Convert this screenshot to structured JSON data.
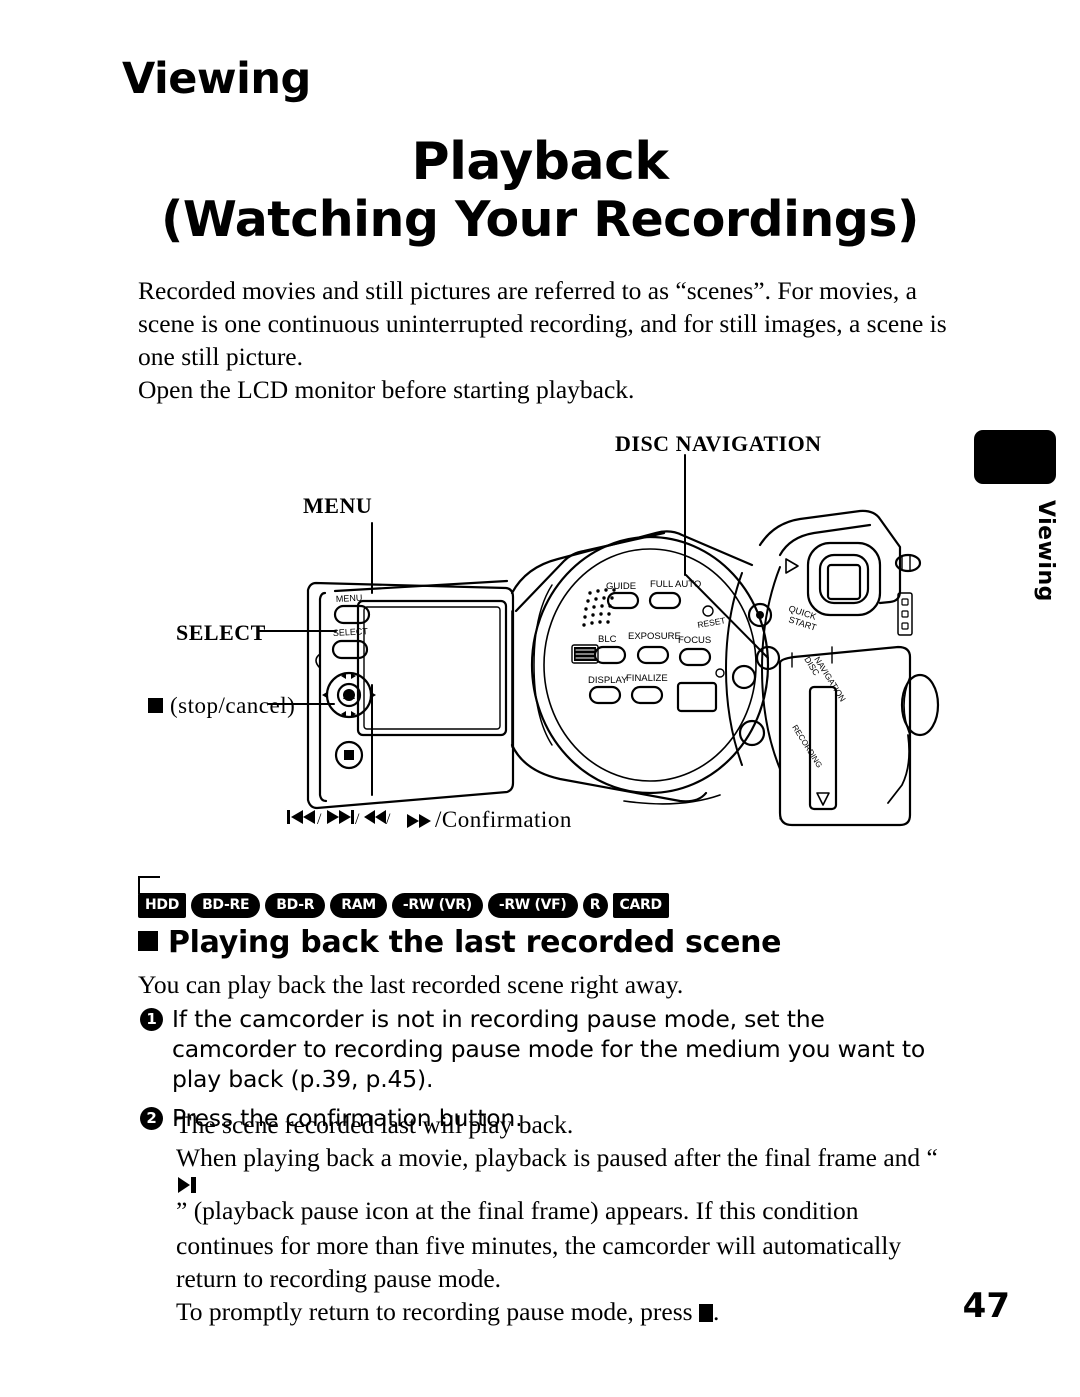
{
  "chapter": {
    "title": "Viewing"
  },
  "doc_title": {
    "line1": "Playback",
    "line2": "(Watching Your Recordings)"
  },
  "intro": {
    "p1": "Recorded movies and still pictures are referred to as “scenes”. For movies, a scene is one continuous uninterrupted recording, and for still images, a scene is one still picture.",
    "p2": "Open the LCD monitor before starting playback."
  },
  "side_tab": {
    "label": "Viewing"
  },
  "figure": {
    "callouts": {
      "disc_navigation": "DISC NAVIGATION",
      "menu": "MENU",
      "select": "SELECT",
      "stop_cancel": "(stop/cancel)",
      "confirmation": "/Confirmation",
      "confirmation_glyphs": "⏮/⏭/◀◀/▶▶"
    },
    "device_labels": {
      "menu": "MENU",
      "select": "SELECT",
      "guide": "GUIDE",
      "full_auto": "FULL AUTO",
      "reset": "RESET",
      "blc": "BLC",
      "exposure": "EXPOSURE",
      "focus": "FOCUS",
      "display": "DISPLAY",
      "finalize": "FINALIZE",
      "quick_start": "QUICK START",
      "disc_navigation": "DISC NAVIGATION",
      "recording": "RECORDING"
    }
  },
  "media_badges": [
    {
      "text": "HDD",
      "shape": "rect"
    },
    {
      "text": "BD-RE",
      "shape": "pill"
    },
    {
      "text": "BD-R",
      "shape": "pill"
    },
    {
      "text": "RAM",
      "shape": "pill"
    },
    {
      "text": "-RW (VR)",
      "shape": "pill"
    },
    {
      "text": "-RW (VF)",
      "shape": "pill"
    },
    {
      "text": "R",
      "shape": "circle"
    },
    {
      "text": "CARD",
      "shape": "rect"
    }
  ],
  "section": {
    "heading": "Playing back the last recorded scene",
    "subtitle": "You can play back the last recorded scene right away."
  },
  "steps": [
    {
      "num": "1",
      "text": "If the camcorder is not in recording pause mode, set the camcorder to recording pause mode for the medium you want to play back (p.39, p.45)."
    },
    {
      "num": "2",
      "text": "Press the confirmation button."
    }
  ],
  "closing": {
    "p1": "The scene recorded last will play back.",
    "p2_a": "When playing back a movie, playback is paused after the final frame and “",
    "p2_glyph": "▶❙",
    "p2_b": "” (playback pause icon at the final frame) appears. If this condition continues for more than five minutes, the camcorder will automatically return to recording pause mode.",
    "p3_a": "To promptly return to recording pause mode, press ",
    "p3_b": "."
  },
  "footer": {
    "page_number": "47"
  }
}
